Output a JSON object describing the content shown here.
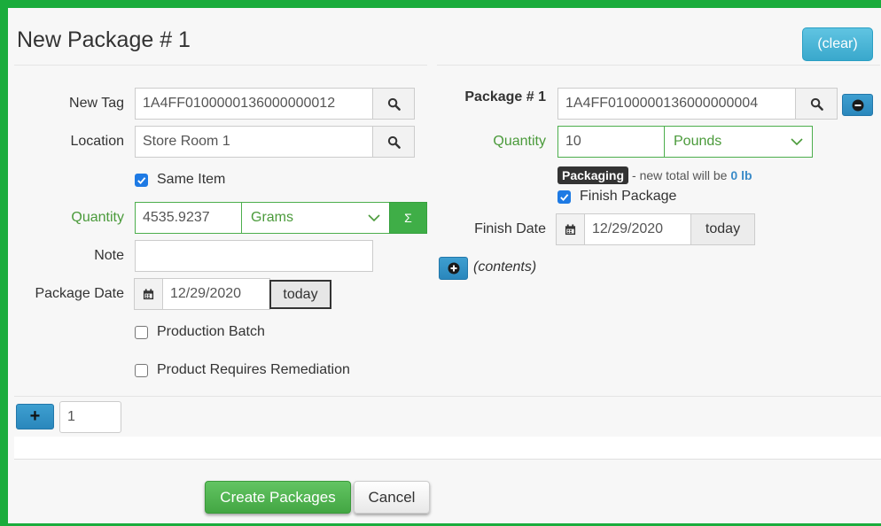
{
  "header": {
    "title": "New Package # 1",
    "clear_label": "(clear)"
  },
  "left": {
    "new_tag": {
      "label": "New Tag",
      "value": "1A4FF0100000136000000012"
    },
    "location": {
      "label": "Location",
      "value": "Store Room 1"
    },
    "same_item": {
      "label": "Same Item",
      "checked": true
    },
    "quantity": {
      "label": "Quantity",
      "value": "4535.9237",
      "unit": "Grams",
      "sum_symbol": "Σ"
    },
    "note": {
      "label": "Note",
      "value": ""
    },
    "package_date": {
      "label": "Package Date",
      "value": "12/29/2020",
      "today_label": "today"
    },
    "production_batch": {
      "label": "Production Batch",
      "checked": false
    },
    "requires_remediation": {
      "label": "Product Requires Remediation",
      "checked": false
    }
  },
  "right": {
    "package": {
      "label": "Package # 1",
      "value": "1A4FF0100000136000000004"
    },
    "quantity": {
      "label": "Quantity",
      "value": "10",
      "unit": "Pounds"
    },
    "packaging_badge": "Packaging",
    "new_total_text": "- new total will be",
    "new_total_value": "0 lb",
    "finish_package": {
      "label": "Finish Package",
      "checked": true
    },
    "finish_date": {
      "label": "Finish Date",
      "value": "12/29/2020",
      "today_label": "today"
    },
    "contents_label": "(contents)"
  },
  "footer": {
    "add_symbol": "+",
    "count_value": "1",
    "create_label": "Create Packages",
    "cancel_label": "Cancel"
  },
  "colors": {
    "frame": "#1aac3c",
    "accent_blue": "#5bc0de",
    "success": "#4cae4c"
  }
}
